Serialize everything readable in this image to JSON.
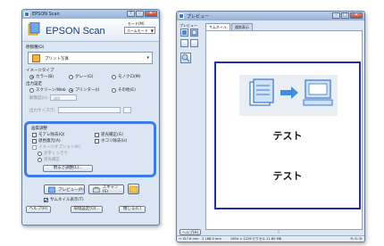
{
  "scan_window": {
    "title": "EPSON Scan",
    "brand": "EPSON Scan",
    "mode_label": "モード(M)",
    "mode_value": "ホームモード",
    "doc_type_label": "原稿種(D)",
    "doc_type_value": "プリント写真",
    "image_type_label": "イメージタイプ",
    "image_type_options": [
      "カラー(B)",
      "グレー(G)",
      "モノクロ(M)"
    ],
    "image_type_selected": 0,
    "output_label": "出力設定",
    "output_options": [
      "スクリーン/Web",
      "プリンター(I)",
      "その他(E)"
    ],
    "output_selected": 1,
    "resolution_label": "解像度(U)",
    "resolution_value": "300",
    "size_label": "出力サイズ(T)",
    "adjust": {
      "title": "画質調整",
      "left_items": [
        "モアレ除去(Q)",
        "退色復元(A)",
        "イメージオプション(K)"
      ],
      "sub_items": [
        "文字くっきり",
        "逆光補正"
      ],
      "right_items": [
        "逆光補正(G)",
        "ホコリ除去(U)"
      ],
      "button": "明るさ調整(L)..."
    },
    "preview_button": "プレビュー(P)",
    "scan_button": "スキャン(S)",
    "thumbnail_label": "サムネイル表示(T)",
    "help_button": "ヘルプ(H)",
    "config_button": "環境設定(O)...",
    "close_button": "閉じる(C)"
  },
  "preview_window": {
    "title": "プレビュー",
    "tabs": [
      "サムネイル",
      "通常表示"
    ],
    "side_label": "プレビュー",
    "test_text_1": "テスト",
    "test_text_2": "テスト",
    "help_button": "ヘルプ(H)",
    "status_left": "157.6 mm",
    "status_mid": "168.5 mm",
    "status_size": "1654 × 1226 ピクセル 11.80 MB",
    "status_rgb": "R: G: B:"
  }
}
